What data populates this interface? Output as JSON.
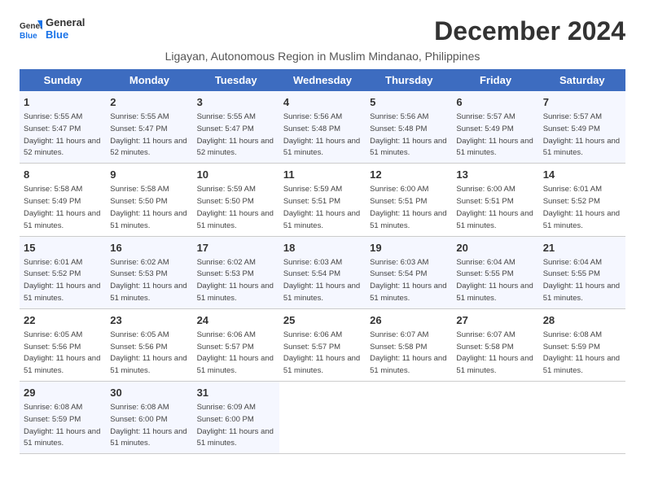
{
  "logo": {
    "general": "General",
    "blue": "Blue"
  },
  "title": "December 2024",
  "subtitle": "Ligayan, Autonomous Region in Muslim Mindanao, Philippines",
  "headers": [
    "Sunday",
    "Monday",
    "Tuesday",
    "Wednesday",
    "Thursday",
    "Friday",
    "Saturday"
  ],
  "weeks": [
    [
      {
        "day": "1",
        "sunrise": "5:55 AM",
        "sunset": "5:47 PM",
        "daylight": "11 hours and 52 minutes."
      },
      {
        "day": "2",
        "sunrise": "5:55 AM",
        "sunset": "5:47 PM",
        "daylight": "11 hours and 52 minutes."
      },
      {
        "day": "3",
        "sunrise": "5:55 AM",
        "sunset": "5:47 PM",
        "daylight": "11 hours and 52 minutes."
      },
      {
        "day": "4",
        "sunrise": "5:56 AM",
        "sunset": "5:48 PM",
        "daylight": "11 hours and 51 minutes."
      },
      {
        "day": "5",
        "sunrise": "5:56 AM",
        "sunset": "5:48 PM",
        "daylight": "11 hours and 51 minutes."
      },
      {
        "day": "6",
        "sunrise": "5:57 AM",
        "sunset": "5:49 PM",
        "daylight": "11 hours and 51 minutes."
      },
      {
        "day": "7",
        "sunrise": "5:57 AM",
        "sunset": "5:49 PM",
        "daylight": "11 hours and 51 minutes."
      }
    ],
    [
      {
        "day": "8",
        "sunrise": "5:58 AM",
        "sunset": "5:49 PM",
        "daylight": "11 hours and 51 minutes."
      },
      {
        "day": "9",
        "sunrise": "5:58 AM",
        "sunset": "5:50 PM",
        "daylight": "11 hours and 51 minutes."
      },
      {
        "day": "10",
        "sunrise": "5:59 AM",
        "sunset": "5:50 PM",
        "daylight": "11 hours and 51 minutes."
      },
      {
        "day": "11",
        "sunrise": "5:59 AM",
        "sunset": "5:51 PM",
        "daylight": "11 hours and 51 minutes."
      },
      {
        "day": "12",
        "sunrise": "6:00 AM",
        "sunset": "5:51 PM",
        "daylight": "11 hours and 51 minutes."
      },
      {
        "day": "13",
        "sunrise": "6:00 AM",
        "sunset": "5:51 PM",
        "daylight": "11 hours and 51 minutes."
      },
      {
        "day": "14",
        "sunrise": "6:01 AM",
        "sunset": "5:52 PM",
        "daylight": "11 hours and 51 minutes."
      }
    ],
    [
      {
        "day": "15",
        "sunrise": "6:01 AM",
        "sunset": "5:52 PM",
        "daylight": "11 hours and 51 minutes."
      },
      {
        "day": "16",
        "sunrise": "6:02 AM",
        "sunset": "5:53 PM",
        "daylight": "11 hours and 51 minutes."
      },
      {
        "day": "17",
        "sunrise": "6:02 AM",
        "sunset": "5:53 PM",
        "daylight": "11 hours and 51 minutes."
      },
      {
        "day": "18",
        "sunrise": "6:03 AM",
        "sunset": "5:54 PM",
        "daylight": "11 hours and 51 minutes."
      },
      {
        "day": "19",
        "sunrise": "6:03 AM",
        "sunset": "5:54 PM",
        "daylight": "11 hours and 51 minutes."
      },
      {
        "day": "20",
        "sunrise": "6:04 AM",
        "sunset": "5:55 PM",
        "daylight": "11 hours and 51 minutes."
      },
      {
        "day": "21",
        "sunrise": "6:04 AM",
        "sunset": "5:55 PM",
        "daylight": "11 hours and 51 minutes."
      }
    ],
    [
      {
        "day": "22",
        "sunrise": "6:05 AM",
        "sunset": "5:56 PM",
        "daylight": "11 hours and 51 minutes."
      },
      {
        "day": "23",
        "sunrise": "6:05 AM",
        "sunset": "5:56 PM",
        "daylight": "11 hours and 51 minutes."
      },
      {
        "day": "24",
        "sunrise": "6:06 AM",
        "sunset": "5:57 PM",
        "daylight": "11 hours and 51 minutes."
      },
      {
        "day": "25",
        "sunrise": "6:06 AM",
        "sunset": "5:57 PM",
        "daylight": "11 hours and 51 minutes."
      },
      {
        "day": "26",
        "sunrise": "6:07 AM",
        "sunset": "5:58 PM",
        "daylight": "11 hours and 51 minutes."
      },
      {
        "day": "27",
        "sunrise": "6:07 AM",
        "sunset": "5:58 PM",
        "daylight": "11 hours and 51 minutes."
      },
      {
        "day": "28",
        "sunrise": "6:08 AM",
        "sunset": "5:59 PM",
        "daylight": "11 hours and 51 minutes."
      }
    ],
    [
      {
        "day": "29",
        "sunrise": "6:08 AM",
        "sunset": "5:59 PM",
        "daylight": "11 hours and 51 minutes."
      },
      {
        "day": "30",
        "sunrise": "6:08 AM",
        "sunset": "6:00 PM",
        "daylight": "11 hours and 51 minutes."
      },
      {
        "day": "31",
        "sunrise": "6:09 AM",
        "sunset": "6:00 PM",
        "daylight": "11 hours and 51 minutes."
      },
      null,
      null,
      null,
      null
    ]
  ]
}
